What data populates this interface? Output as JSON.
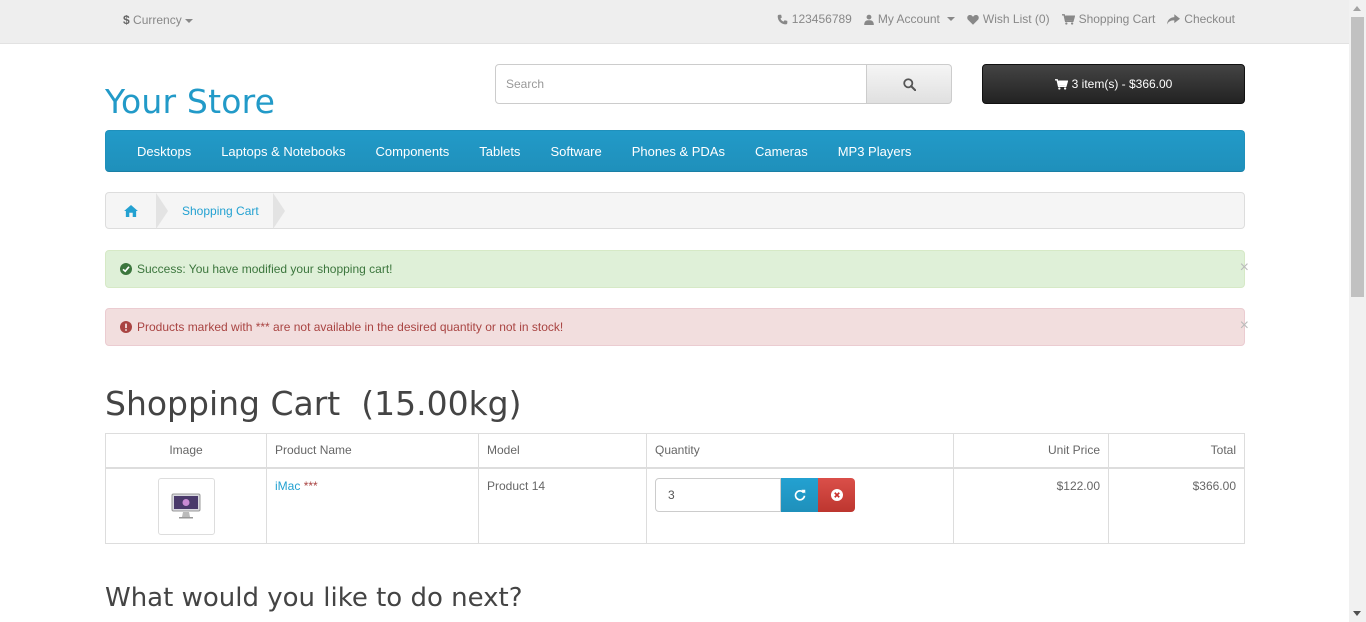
{
  "topbar": {
    "currency_symbol": "$",
    "currency_label": "Currency",
    "phone": "123456789",
    "my_account": "My Account",
    "wishlist": "Wish List (0)",
    "shopping_cart": "Shopping Cart",
    "checkout": "Checkout"
  },
  "header": {
    "logo": "Your Store",
    "search_placeholder": "Search",
    "cart_button": "3 item(s) - $366.00"
  },
  "menu": {
    "items": [
      "Desktops",
      "Laptops & Notebooks",
      "Components",
      "Tablets",
      "Software",
      "Phones & PDAs",
      "Cameras",
      "MP3 Players"
    ]
  },
  "breadcrumb": {
    "current": "Shopping Cart"
  },
  "alerts": {
    "success": "Success: You have modified your shopping cart!",
    "danger": "Products marked with *** are not available in the desired quantity or not in stock!",
    "close": "×"
  },
  "page": {
    "title": "Shopping Cart  (15.00kg)",
    "next_heading": "What would you like to do next?"
  },
  "cart_table": {
    "headers": {
      "image": "Image",
      "name": "Product Name",
      "model": "Model",
      "quantity": "Quantity",
      "unit_price": "Unit Price",
      "total": "Total"
    },
    "rows": [
      {
        "name": "iMac",
        "stock_flag": "***",
        "model": "Product 14",
        "quantity": "3",
        "unit_price": "$122.00",
        "total": "$366.00"
      }
    ]
  },
  "colors": {
    "brand": "#229ac8",
    "link": "#23a1d1",
    "success_bg": "#dff0d8",
    "danger_bg": "#f2dede",
    "remove_button": "#da4f49"
  }
}
